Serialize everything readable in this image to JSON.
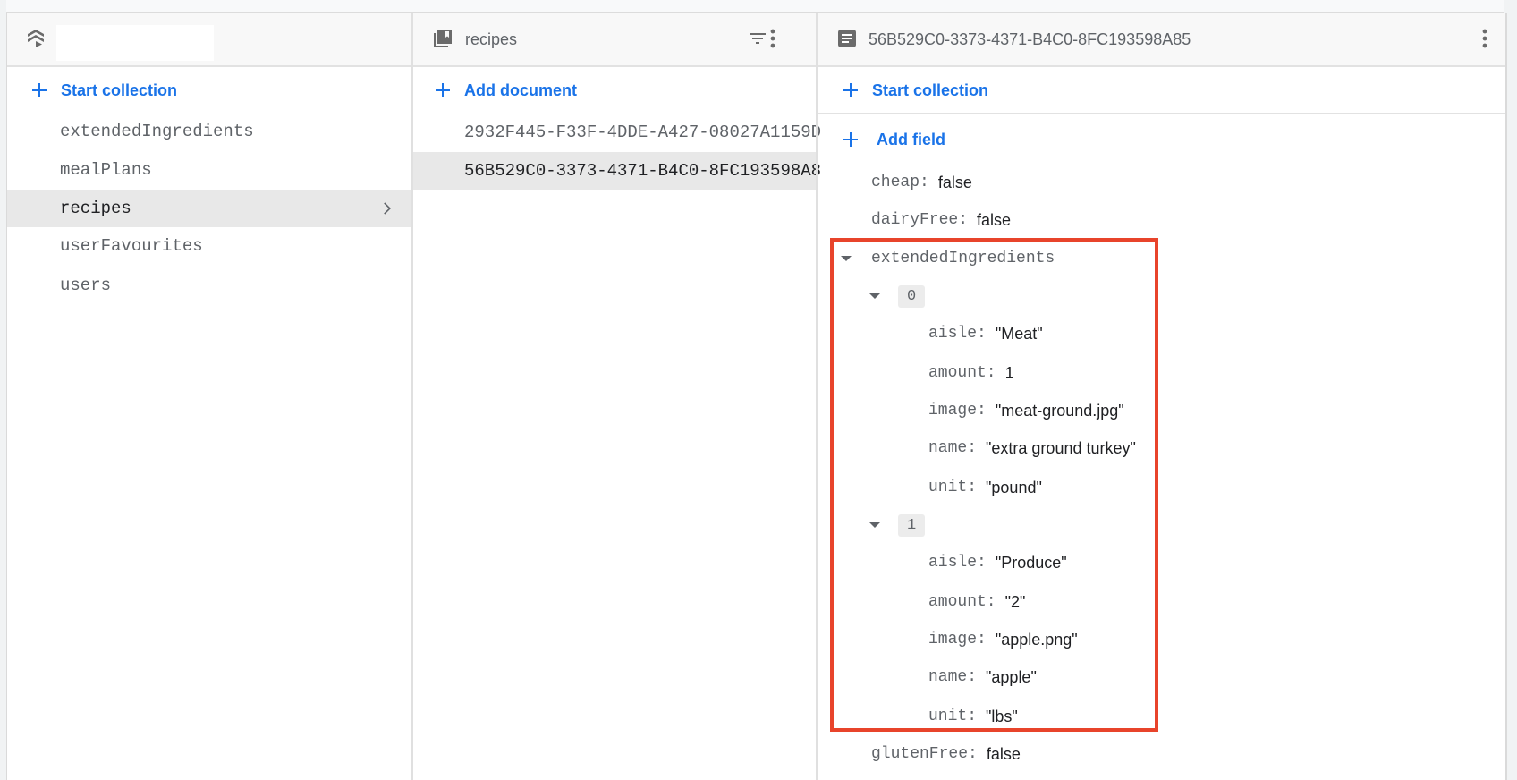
{
  "colors": {
    "accent": "#1a73e8",
    "highlight_box": "#e8442b",
    "selected_row": "#e8e8e8"
  },
  "root_panel": {
    "header_icon": "firestore-stack-icon",
    "project_name": "",
    "start_collection_label": "Start collection",
    "collections": [
      {
        "label": "extendedIngredients",
        "selected": false
      },
      {
        "label": "mealPlans",
        "selected": false
      },
      {
        "label": "recipes",
        "selected": true
      },
      {
        "label": "userFavourites",
        "selected": false
      },
      {
        "label": "users",
        "selected": false
      }
    ]
  },
  "collection_panel": {
    "header_icon": "collection-icon",
    "title": "recipes",
    "filter_icon": "filter-icon",
    "more_icon": "more-vert-icon",
    "add_document_label": "Add document",
    "documents": [
      {
        "id": "2932F445-F33F-4DDE-A427-08027A1159D",
        "selected": false
      },
      {
        "id": "56B529C0-3373-4371-B4C0-8FC193598A8",
        "selected": true
      }
    ]
  },
  "document_panel": {
    "header_icon": "document-icon",
    "title": "56B529C0-3373-4371-B4C0-8FC193598A85",
    "more_icon": "more-vert-icon",
    "start_collection_label": "Start collection",
    "add_field_label": "Add field",
    "fields_top": [
      {
        "key": "cheap:",
        "value": "false"
      },
      {
        "key": "dairyFree:",
        "value": "false"
      }
    ],
    "extended": {
      "key": "extendedIngredients",
      "items": [
        {
          "index": "0",
          "fields": [
            {
              "key": "aisle:",
              "value": "\"Meat\""
            },
            {
              "key": "amount:",
              "value": "1"
            },
            {
              "key": "image:",
              "value": "\"meat-ground.jpg\""
            },
            {
              "key": "name:",
              "value": "\"extra ground turkey\""
            },
            {
              "key": "unit:",
              "value": "\"pound\""
            }
          ]
        },
        {
          "index": "1",
          "fields": [
            {
              "key": "aisle:",
              "value": "\"Produce\""
            },
            {
              "key": "amount:",
              "value": "\"2\""
            },
            {
              "key": "image:",
              "value": "\"apple.png\""
            },
            {
              "key": "name:",
              "value": "\"apple\""
            },
            {
              "key": "unit:",
              "value": "\"lbs\""
            }
          ]
        }
      ]
    },
    "fields_bottom": [
      {
        "key": "glutenFree:",
        "value": "false"
      }
    ]
  }
}
